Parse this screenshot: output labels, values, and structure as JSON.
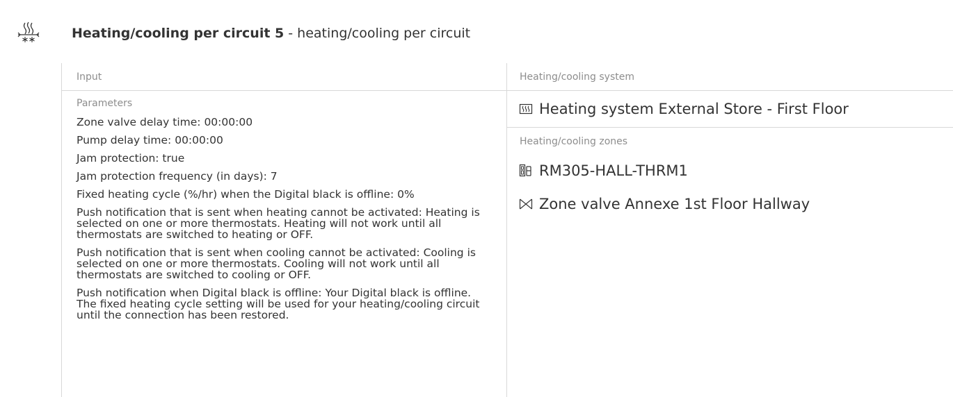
{
  "header": {
    "icon": "heating-cooling-icon",
    "title_strong": "Heating/cooling per circuit 5",
    "title_rest": " - heating/cooling per circuit"
  },
  "input": {
    "header": "Input",
    "parameters_header": "Parameters",
    "parameters": [
      "Zone valve delay time: 00:00:00",
      "Pump delay time: 00:00:00",
      "Jam protection: true",
      "Jam protection frequency (in days): 7",
      "Fixed heating cycle (%/hr) when the Digital black is offline: 0%",
      "Push notification that is sent when heating cannot be activated: Heating is selected on one or more thermostats. Heating will not work until all thermostats are switched to heating or OFF.",
      "Push notification that is sent when cooling cannot be activated: Cooling is selected on one or more thermostats. Cooling will not work until all thermostats are switched to cooling or OFF.",
      "Push notification when Digital black is offline: Your Digital black is offline. The fixed heating cycle setting will be used for your heating/cooling circuit until the connection has been restored."
    ]
  },
  "system": {
    "header": "Heating/cooling system",
    "icon": "heating-system-icon",
    "label": "Heating system External Store - First Floor"
  },
  "zones": {
    "header": "Heating/cooling zones",
    "items": [
      {
        "icon": "thermostat-icon",
        "label": "RM305-HALL-THRM1"
      },
      {
        "icon": "zone-valve-icon",
        "label": "Zone valve Annexe 1st Floor Hallway"
      }
    ]
  }
}
